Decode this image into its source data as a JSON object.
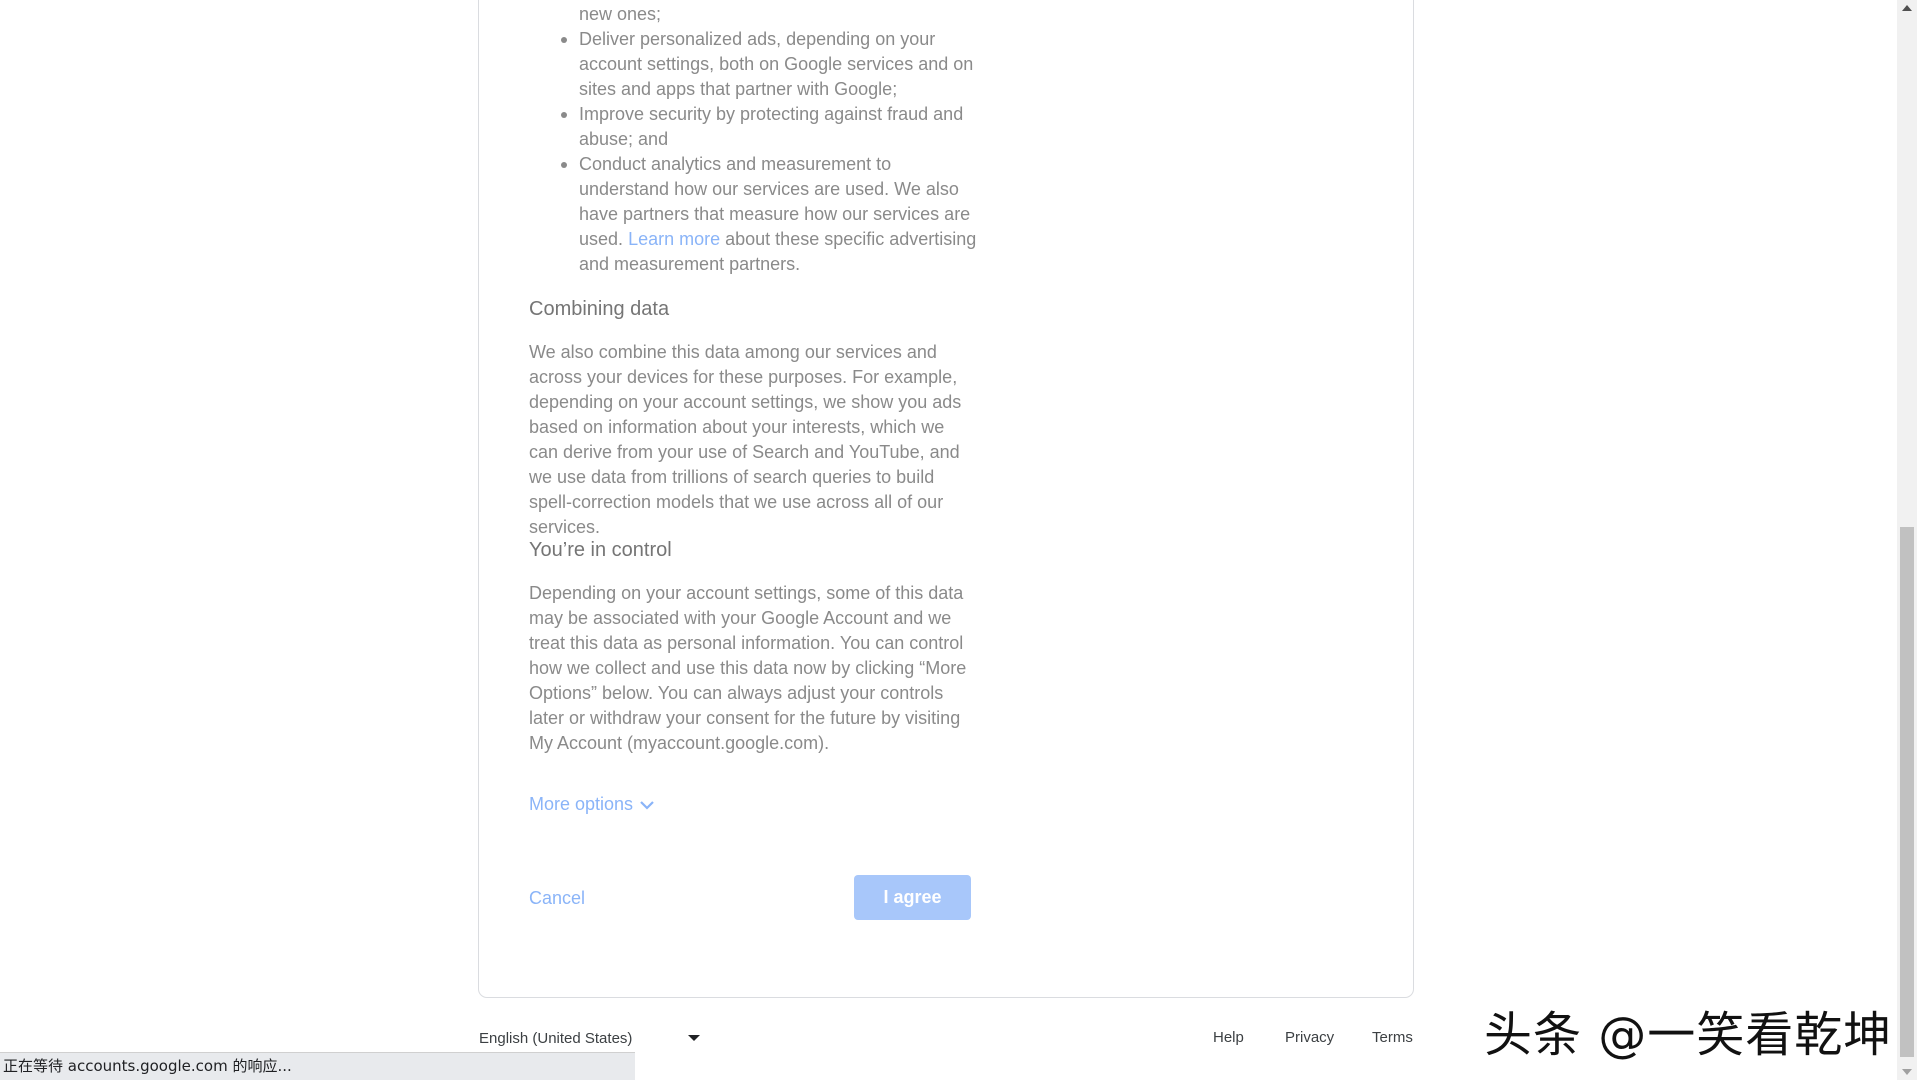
{
  "bullets": [
    {
      "text": "new ones;"
    },
    {
      "text": "Deliver personalized ads, depending on your account settings, both on Google services and on sites and apps that partner with Google;"
    },
    {
      "text": "Improve security by protecting against fraud and abuse; and"
    },
    {
      "text_before": "Conduct analytics and measurement to understand how our services are used. We also have partners that measure how our services are used.",
      "link": "Learn more",
      "text_after": "about these specific advertising and measurement partners."
    }
  ],
  "combining": {
    "heading": "Combining data",
    "body": "We also combine this data among our services and across your devices for these purposes. For example, depending on your account settings, we show you ads based on information about your interests, which we can derive from your use of Search and YouTube, and we use data from trillions of search queries to build spell-correction models that we use across all of our services."
  },
  "control": {
    "heading": "You’re in control",
    "body": "Depending on your account settings, some of this data may be associated with your Google Account and we treat this data as personal information. You can control how we collect and use this data now by clicking “More Options” below. You can always adjust your controls later or withdraw your consent for the future by visiting My Account (myaccount.google.com)."
  },
  "more_options": "More options",
  "cancel": "Cancel",
  "agree": "I agree",
  "footer": {
    "language": "English (United States)",
    "help": "Help",
    "privacy": "Privacy",
    "terms": "Terms"
  },
  "status_text": "正在等待 accounts.google.com 的响应...",
  "watermark": "头条 @一笑看乾坤",
  "colors": {
    "link": "#8ab4f8",
    "agree_button": "#a8c7fa"
  }
}
